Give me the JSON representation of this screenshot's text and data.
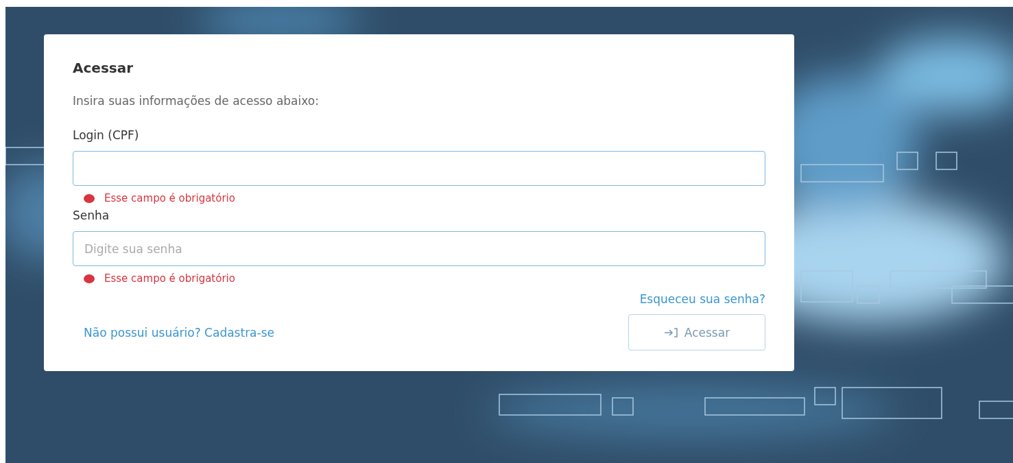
{
  "title": "Acessar",
  "subtitle": "Insira suas informações de acesso abaixo:",
  "fields": [
    {
      "label": "Login (CPF)",
      "error": "Esse campo é obrigatório"
    },
    {
      "label": "Senha",
      "placeholder": "Digite sua senha",
      "error": "Esse campo é obrigatório"
    }
  ],
  "forgot_link": "Esqueceu sua senha?",
  "register_link": "Não possui usuário? Cadastra-se",
  "submit_button": "Acessar"
}
